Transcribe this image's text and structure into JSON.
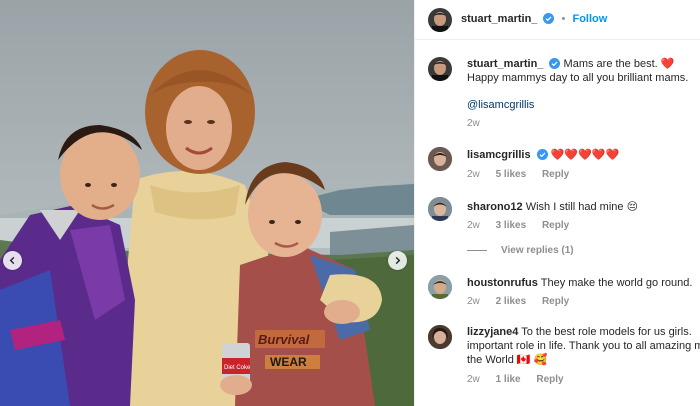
{
  "header": {
    "username": "stuart_martin_",
    "separator": "•",
    "follow_label": "Follow"
  },
  "caption": {
    "username": "stuart_martin_",
    "line1": "Mams are the best. ❤️",
    "line2": "Happy mammys day to all you brilliant mams.",
    "mention": "@lisamcgrillis",
    "time": "2w"
  },
  "comments": [
    {
      "username": "lisamcgrillis",
      "verified": true,
      "text": "❤️❤️❤️❤️❤️",
      "time": "2w",
      "likes": "5 likes",
      "reply_label": "Reply"
    },
    {
      "username": "sharono12",
      "verified": false,
      "text": "Wish I still had mine 😔",
      "time": "2w",
      "likes": "3 likes",
      "reply_label": "Reply",
      "view_replies": "View replies (1)"
    },
    {
      "username": "houstonrufus",
      "verified": false,
      "text": "They make the world go round.",
      "time": "2w",
      "likes": "2 likes",
      "reply_label": "Reply"
    },
    {
      "username": "lizzyjane4",
      "verified": false,
      "text_line1": "To the best role models for us girls.",
      "text_line2": "important role in life. Thank you to all amazing m",
      "text_line3": "the World 🇨🇦 🥰",
      "time": "2w",
      "likes": "1 like",
      "reply_label": "Reply"
    }
  ],
  "photo": {
    "can_label": "Diet Coke",
    "shirt_text_1": "Burvival",
    "shirt_text_2": "WEAR"
  },
  "icons": {
    "prev": "chevron-left-icon",
    "next": "chevron-right-icon",
    "verified": "verified-badge-icon"
  },
  "colors": {
    "link": "#0095f6",
    "verified": "#3897f0",
    "muted": "#8e8e8e"
  }
}
